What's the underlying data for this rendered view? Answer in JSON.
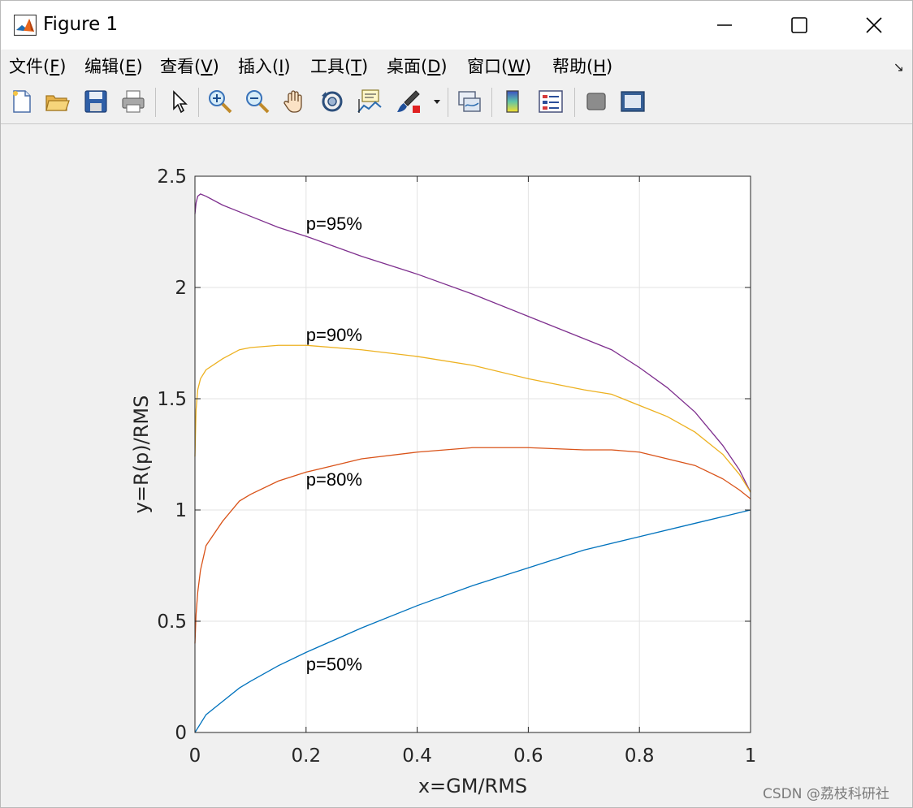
{
  "window": {
    "title": "Figure 1"
  },
  "menu": [
    {
      "text": "文件(",
      "key": "F",
      "end": ")"
    },
    {
      "text": "编辑(",
      "key": "E",
      "end": ")"
    },
    {
      "text": "查看(",
      "key": "V",
      "end": ")"
    },
    {
      "text": "插入(",
      "key": "I",
      "end": ")"
    },
    {
      "text": "工具(",
      "key": "T",
      "end": ")"
    },
    {
      "text": "桌面(",
      "key": "D",
      "end": ")"
    },
    {
      "text": "窗口(",
      "key": "W",
      "end": ")"
    },
    {
      "text": "帮助(",
      "key": "H",
      "end": ")"
    }
  ],
  "toolbar": {
    "icons": [
      "new-figure-icon",
      "open-file-icon",
      "save-icon",
      "print-icon",
      "pointer-icon",
      "zoom-in-icon",
      "zoom-out-icon",
      "pan-hand-icon",
      "rotate-3d-icon",
      "data-cursor-icon",
      "brush-icon",
      "link-plot-icon",
      "colorbar-icon",
      "legend-icon",
      "hide-plot-tools-icon",
      "show-plot-tools-icon"
    ]
  },
  "watermark": "CSDN @荔枝科研社",
  "chart_data": {
    "type": "line",
    "xlabel": "x=GM/RMS",
    "ylabel": "y=R(p)/RMS",
    "xlim": [
      0,
      1
    ],
    "ylim": [
      0,
      2.5
    ],
    "xticks": [
      "0",
      "0.2",
      "0.4",
      "0.6",
      "0.8",
      "1"
    ],
    "yticks": [
      "0",
      "0.5",
      "1",
      "1.5",
      "2",
      "2.5"
    ],
    "grid": true,
    "series": [
      {
        "name": "p=95%",
        "color": "#7e2f8e",
        "x": [
          0,
          0.002,
          0.005,
          0.01,
          0.02,
          0.05,
          0.1,
          0.15,
          0.2,
          0.3,
          0.4,
          0.5,
          0.6,
          0.7,
          0.75,
          0.8,
          0.85,
          0.9,
          0.95,
          0.98,
          1.0
        ],
        "y": [
          2.33,
          2.38,
          2.41,
          2.42,
          2.41,
          2.37,
          2.32,
          2.27,
          2.23,
          2.14,
          2.06,
          1.97,
          1.87,
          1.77,
          1.72,
          1.64,
          1.55,
          1.44,
          1.29,
          1.18,
          1.08
        ]
      },
      {
        "name": "p=90%",
        "color": "#edb120",
        "x": [
          0,
          0.002,
          0.005,
          0.01,
          0.02,
          0.05,
          0.08,
          0.1,
          0.15,
          0.2,
          0.3,
          0.4,
          0.5,
          0.6,
          0.7,
          0.75,
          0.8,
          0.85,
          0.9,
          0.95,
          0.98,
          1.0
        ],
        "y": [
          1.24,
          1.45,
          1.54,
          1.59,
          1.63,
          1.68,
          1.72,
          1.73,
          1.74,
          1.74,
          1.72,
          1.69,
          1.65,
          1.59,
          1.54,
          1.52,
          1.47,
          1.42,
          1.35,
          1.25,
          1.16,
          1.08
        ]
      },
      {
        "name": "p=80%",
        "color": "#d95319",
        "x": [
          0,
          0.002,
          0.005,
          0.01,
          0.02,
          0.05,
          0.08,
          0.1,
          0.15,
          0.2,
          0.25,
          0.3,
          0.4,
          0.5,
          0.6,
          0.7,
          0.75,
          0.8,
          0.85,
          0.9,
          0.95,
          0.98,
          1.0
        ],
        "y": [
          0.4,
          0.53,
          0.63,
          0.73,
          0.84,
          0.95,
          1.04,
          1.07,
          1.13,
          1.17,
          1.2,
          1.23,
          1.26,
          1.28,
          1.28,
          1.27,
          1.27,
          1.26,
          1.23,
          1.2,
          1.14,
          1.09,
          1.05
        ]
      },
      {
        "name": "p=50%",
        "color": "#0072bd",
        "x": [
          0,
          0.01,
          0.02,
          0.05,
          0.08,
          0.1,
          0.15,
          0.2,
          0.3,
          0.4,
          0.5,
          0.6,
          0.7,
          0.8,
          0.9,
          1.0
        ],
        "y": [
          0,
          0.04,
          0.08,
          0.14,
          0.2,
          0.23,
          0.3,
          0.36,
          0.47,
          0.57,
          0.66,
          0.74,
          0.82,
          0.88,
          0.94,
          1.0
        ]
      }
    ],
    "annotations": [
      {
        "text": "p=95%",
        "x": 0.2,
        "y": 2.26
      },
      {
        "text": "p=90%",
        "x": 0.2,
        "y": 1.76
      },
      {
        "text": "p=80%",
        "x": 0.2,
        "y": 1.11
      },
      {
        "text": "p=50%",
        "x": 0.2,
        "y": 0.28
      }
    ]
  }
}
